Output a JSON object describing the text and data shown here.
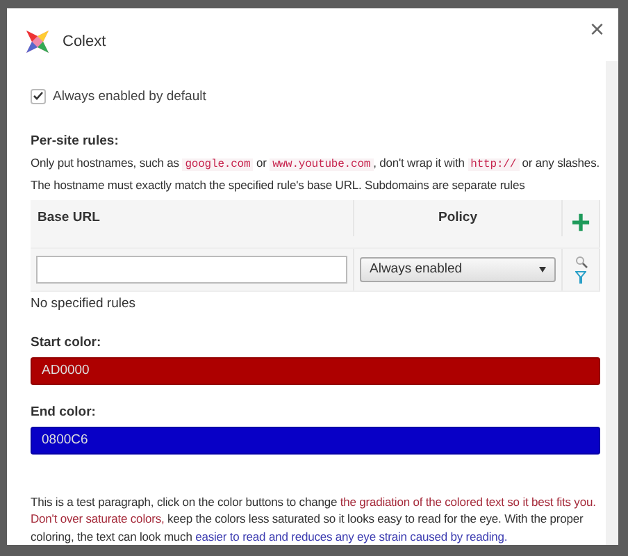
{
  "dialog": {
    "title": "Colext",
    "close": "×"
  },
  "default_toggle": {
    "label": "Always enabled by default",
    "checked": true
  },
  "rules": {
    "heading": "Per-site rules:",
    "description": [
      {
        "kind": "text",
        "text": "Only put hostnames, such as "
      },
      {
        "kind": "code",
        "text": "google.com"
      },
      {
        "kind": "text",
        "text": " or "
      },
      {
        "kind": "code",
        "text": "www.youtube.com"
      },
      {
        "kind": "text",
        "text": ", don't wrap it with "
      },
      {
        "kind": "code",
        "text": "http://"
      },
      {
        "kind": "text",
        "text": " or any slashes. The hostname must exactly match the specified rule's base URL. Subdomains are separate rules"
      }
    ],
    "columns": [
      "Base URL",
      "Policy"
    ],
    "add": "+",
    "policy_value": "Always enabled",
    "empty": "No specified rules"
  },
  "start_color": {
    "label": "Start color:",
    "value": "AD0000",
    "color": "#ad0000"
  },
  "end_color": {
    "label": "End color:",
    "value": "0800C6",
    "color": "#0800c6"
  },
  "paragraph": [
    {
      "text": "This is a test paragraph, click on the color buttons to change ",
      "color": "#333333"
    },
    {
      "text": "the gradiation of the colored text so it best fits you. Don't over saturate colors, ",
      "color": "#a52a3a"
    },
    {
      "text": "keep the colors less saturated so it looks easy to read for the eye. With the proper coloring, the text can look much ",
      "color": "#333333"
    },
    {
      "text": "easier to read and reduces any eye strain caused by reading.",
      "color": "#3b3bb0"
    }
  ]
}
